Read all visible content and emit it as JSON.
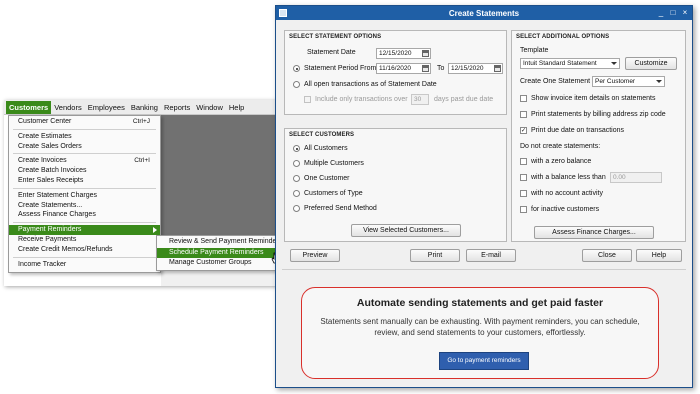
{
  "menubar": {
    "items": [
      "Customers",
      "Vendors",
      "Employees",
      "Banking",
      "Reports",
      "Window",
      "Help"
    ]
  },
  "customers_menu": {
    "items": [
      {
        "label": "Customer Center",
        "shortcut": "Ctrl+J"
      },
      {
        "label": "Create Estimates",
        "shortcut": ""
      },
      {
        "label": "Create Sales Orders",
        "shortcut": ""
      },
      {
        "label": "Create Invoices",
        "shortcut": "Ctrl+I"
      },
      {
        "label": "Create Batch Invoices",
        "shortcut": ""
      },
      {
        "label": "Enter Sales Receipts",
        "shortcut": ""
      },
      {
        "label": "Enter Statement Charges",
        "shortcut": ""
      },
      {
        "label": "Create Statements...",
        "shortcut": ""
      },
      {
        "label": "Assess Finance Charges",
        "shortcut": ""
      },
      {
        "label": "Payment Reminders",
        "shortcut": ""
      },
      {
        "label": "Receive Payments",
        "shortcut": ""
      },
      {
        "label": "Create Credit Memos/Refunds",
        "shortcut": ""
      },
      {
        "label": "Income Tracker",
        "shortcut": ""
      }
    ]
  },
  "payment_reminders_submenu": {
    "items": [
      "Review & Send Payment Reminders",
      "Schedule Payment Reminders",
      "Manage Customer Groups"
    ]
  },
  "dialog": {
    "title": "Create Statements",
    "statement_options": {
      "section": "SELECT STATEMENT OPTIONS",
      "statement_date_label": "Statement Date",
      "statement_date": "12/15/2020",
      "period_label": "Statement Period From",
      "period_from": "11/16/2020",
      "to_label": "To",
      "period_to": "12/15/2020",
      "open_transactions_label": "All open transactions as of Statement Date",
      "overdue_label": "Include only transactions over",
      "overdue_days": "30",
      "overdue_suffix": "days past due date"
    },
    "customers": {
      "section": "SELECT CUSTOMERS",
      "options": [
        "All Customers",
        "Multiple Customers",
        "One Customer",
        "Customers of Type",
        "Preferred Send Method"
      ],
      "view_button": "View Selected Customers..."
    },
    "additional_options": {
      "section": "SELECT ADDITIONAL OPTIONS",
      "template_label": "Template",
      "template_value": "Intuit Standard Statement",
      "customize_button": "Customize",
      "one_statement_label": "Create One Statement",
      "one_statement_value": "Per Customer",
      "checkboxes": [
        {
          "label": "Show invoice item details on statements",
          "checked": false
        },
        {
          "label": "Print statements by billing address zip code",
          "checked": false
        },
        {
          "label": "Print due date on transactions",
          "checked": true
        }
      ],
      "do_not_create_label": "Do not create statements:",
      "exclusions": [
        {
          "label": "with a zero balance",
          "checked": false
        },
        {
          "label": "with a balance less than",
          "checked": false,
          "value": "0.00"
        },
        {
          "label": "with no account activity",
          "checked": false
        },
        {
          "label": "for inactive customers",
          "checked": false
        }
      ],
      "finance_button": "Assess Finance Charges..."
    },
    "buttons": {
      "preview": "Preview",
      "print": "Print",
      "email": "E-mail",
      "close": "Close",
      "help": "Help"
    },
    "promo": {
      "heading": "Automate sending statements and get paid faster",
      "body": "Statements sent manually can be exhausting. With payment reminders, you can schedule, review, and send statements to your customers, effortlessly.",
      "button": "Go to payment reminders"
    }
  }
}
